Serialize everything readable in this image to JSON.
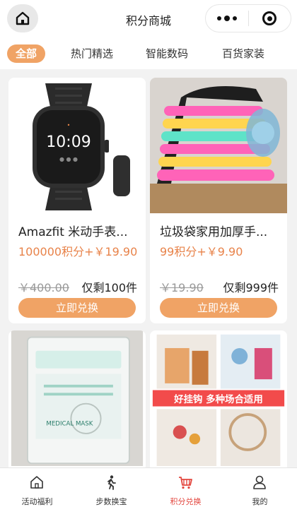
{
  "header": {
    "title": "积分商城",
    "home_icon": "home-icon",
    "more_icon": "more-dots-icon",
    "target_icon": "close-target-icon"
  },
  "tabs": [
    {
      "label": "全部",
      "active": true
    },
    {
      "label": "热门精选",
      "active": false
    },
    {
      "label": "智能数码",
      "active": false
    },
    {
      "label": "百货家装",
      "active": false
    }
  ],
  "colors": {
    "accent": "#f0a365",
    "price": "#e8834a",
    "nav_active": "#e3473f"
  },
  "products": [
    {
      "name": "Amazfit 米动手表...",
      "price": "100000积分+￥19.90",
      "original_price": "￥400.00",
      "stock": "仅剩100件",
      "button": "立即兑换"
    },
    {
      "name": "垃圾袋家用加厚手...",
      "price": "99积分+￥9.90",
      "original_price": "￥19.90",
      "stock": "仅剩999件",
      "button": "立即兑换"
    },
    {
      "image_label": "MEDICAL MASK"
    },
    {
      "image_text": "好挂钩 多种场合适用"
    }
  ],
  "bottom_nav": [
    {
      "label": "活动福利",
      "icon": "home-icon",
      "active": false
    },
    {
      "label": "步数换宝",
      "icon": "walking-icon",
      "active": false
    },
    {
      "label": "积分兑换",
      "icon": "cart-icon",
      "active": true
    },
    {
      "label": "我的",
      "icon": "user-icon",
      "active": false
    }
  ]
}
